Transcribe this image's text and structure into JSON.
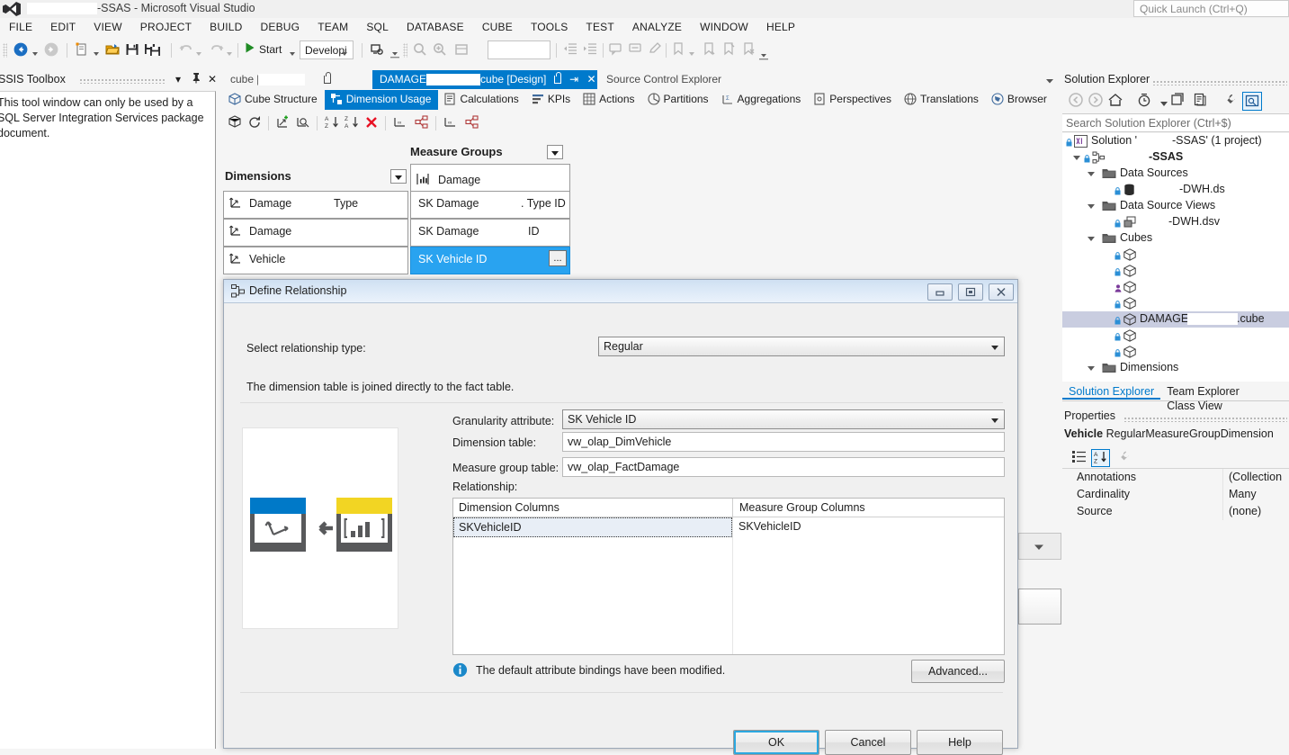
{
  "titlebar": {
    "app_title_suffix": "-SSAS - Microsoft Visual Studio",
    "quick_launch_placeholder": "Quick Launch (Ctrl+Q)"
  },
  "menubar": {
    "items": [
      "FILE",
      "EDIT",
      "VIEW",
      "PROJECT",
      "BUILD",
      "DEBUG",
      "TEAM",
      "SQL",
      "DATABASE",
      "CUBE",
      "TOOLS",
      "TEST",
      "ANALYZE",
      "WINDOW",
      "HELP"
    ]
  },
  "toolbar": {
    "start_label": "Start",
    "config_label": "Developi"
  },
  "ssis_toolbox": {
    "title": "SSIS Toolbox",
    "message": "This tool window can only be used by a SQL Server Integration Services package document.",
    "dropdown_glyph": "▾",
    "pin_glyph": "⇧",
    "close_glyph": "✕"
  },
  "document_tabs": {
    "inactive_tab": "cube [Design]",
    "active_tab_prefix": "DAMAGE",
    "active_tab_suffix": "cube [Design]",
    "third_tab": "Source Control Explorer"
  },
  "designer_tabs": [
    {
      "label": "Cube Structure",
      "icon": "cube-icon",
      "selected": false
    },
    {
      "label": "Dimension Usage",
      "icon": "dimension-usage-icon",
      "selected": true
    },
    {
      "label": "Calculations",
      "icon": "calculations-icon",
      "selected": false
    },
    {
      "label": "KPIs",
      "icon": "kpi-icon",
      "selected": false
    },
    {
      "label": "Actions",
      "icon": "actions-icon",
      "selected": false
    },
    {
      "label": "Partitions",
      "icon": "partitions-icon",
      "selected": false
    },
    {
      "label": "Aggregations",
      "icon": "aggregations-icon",
      "selected": false
    },
    {
      "label": "Perspectives",
      "icon": "perspectives-icon",
      "selected": false
    },
    {
      "label": "Translations",
      "icon": "translations-icon",
      "selected": false
    },
    {
      "label": "Browser",
      "icon": "browser-icon",
      "selected": false
    }
  ],
  "dimension_usage": {
    "measure_groups_label": "Measure Groups",
    "dimensions_label": "Dimensions",
    "measure_group_header": "Damage",
    "rows": [
      {
        "dimension": "Damage",
        "dimension_suffix": "Type",
        "cell": "SK Damage",
        "cell_suffix": ". Type ID",
        "selected": false
      },
      {
        "dimension": "Damage",
        "dimension_suffix": "",
        "cell": "SK Damage",
        "cell_suffix": "ID",
        "selected": false
      },
      {
        "dimension": "Vehicle",
        "dimension_suffix": "",
        "cell": "SK Vehicle ID",
        "cell_suffix": "",
        "selected": true
      }
    ],
    "ellipsis_label": "..."
  },
  "dialog": {
    "title": "Define Relationship",
    "relationship_type_label": "Select relationship type:",
    "relationship_type_value": "Regular",
    "description": "The dimension table is joined directly to the fact table.",
    "granularity_label": "Granularity attribute:",
    "granularity_value": "SK Vehicle ID",
    "dimension_table_label": "Dimension table:",
    "dimension_table_value": "vw_olap_DimVehicle",
    "measure_group_table_label": "Measure group table:",
    "measure_group_table_value": "vw_olap_FactDamage",
    "relationship_label": "Relationship:",
    "table_headers": [
      "Dimension Columns",
      "Measure Group Columns"
    ],
    "table_rows": [
      {
        "dimension_column": "SKVehicleID",
        "measure_group_column": "SKVehicleID"
      }
    ],
    "info_message": "The default attribute bindings have been modified.",
    "advanced_label": "Advanced...",
    "ok_label": "OK",
    "cancel_label": "Cancel",
    "help_label": "Help",
    "minimize_glyph": "minimize-icon",
    "restore_glyph": "restore-icon",
    "close_glyph": "close-icon",
    "graphic": {
      "dimension_color": "#0079c8",
      "fact_color": "#f2d523",
      "body_color": "#58595b"
    }
  },
  "solution_explorer": {
    "title": "Solution Explorer",
    "search_placeholder": "Search Solution Explorer (Ctrl+$)",
    "tree": [
      {
        "label": "Solution '",
        "label2": "-SSAS' (1 project)",
        "indent": 8,
        "level": 0,
        "icon": "solution-icon",
        "expander": "",
        "redact_w": 34,
        "selected": false
      },
      {
        "label": "",
        "label2": "-SSAS",
        "indent": 22,
        "level": 1,
        "icon": "project-icon",
        "expander": "open",
        "redact_w": 44,
        "selected": false,
        "bold": true
      },
      {
        "label": "Data Sources",
        "label2": "",
        "indent": 38,
        "level": 2,
        "icon": "folder-icon",
        "expander": "open",
        "redact_w": 0,
        "selected": false
      },
      {
        "label": "",
        "label2": "-DWH.ds",
        "indent": 58,
        "level": 3,
        "icon": "datasource-icon",
        "expander": "",
        "redact_w": 44,
        "selected": false
      },
      {
        "label": "Data Source Views",
        "label2": "",
        "indent": 38,
        "level": 2,
        "icon": "folder-icon",
        "expander": "open",
        "redact_w": 0,
        "selected": false
      },
      {
        "label": "",
        "label2": "-DWH.dsv",
        "indent": 58,
        "level": 3,
        "icon": "dsv-icon",
        "expander": "",
        "redact_w": 30,
        "selected": false
      },
      {
        "label": "Cubes",
        "label2": "",
        "indent": 38,
        "level": 2,
        "icon": "folder-icon",
        "expander": "open",
        "redact_w": 0,
        "selected": false
      },
      {
        "label": "",
        "label2": "",
        "indent": 58,
        "level": 3,
        "icon": "cube-item-icon",
        "expander": "",
        "redact_w": 80,
        "selected": false
      },
      {
        "label": "",
        "label2": "",
        "indent": 58,
        "level": 3,
        "icon": "cube-item-icon",
        "expander": "",
        "redact_w": 86,
        "selected": false
      },
      {
        "label": "",
        "label2": "",
        "indent": 58,
        "level": 3,
        "icon": "cube-item-icon",
        "expander": "",
        "redact_w": 72,
        "selected": false
      },
      {
        "label": "",
        "label2": "",
        "indent": 58,
        "level": 3,
        "icon": "cube-item-icon",
        "expander": "",
        "redact_w": 64,
        "selected": false
      },
      {
        "label": "DAMAGE",
        "label2": ".cube",
        "indent": 58,
        "level": 3,
        "icon": "cube-item-icon",
        "expander": "",
        "redact_w": 56,
        "selected": true
      },
      {
        "label": "",
        "label2": "",
        "indent": 58,
        "level": 3,
        "icon": "cube-item-icon",
        "expander": "",
        "redact_w": 110,
        "selected": false
      },
      {
        "label": "",
        "label2": "",
        "indent": 58,
        "level": 3,
        "icon": "cube-item-icon",
        "expander": "",
        "redact_w": 72,
        "selected": false
      },
      {
        "label": "Dimensions",
        "label2": "",
        "indent": 38,
        "level": 2,
        "icon": "folder-icon",
        "expander": "open",
        "redact_w": 0,
        "selected": false
      }
    ],
    "bottom_tabs": [
      {
        "label": "Solution Explorer",
        "active": true
      },
      {
        "label": "Team Explorer",
        "active": false
      },
      {
        "label": "Class View",
        "active": false
      }
    ]
  },
  "properties": {
    "title": "Properties",
    "object_name": "Vehicle",
    "object_type": "RegularMeasureGroupDimension",
    "rows": [
      {
        "name": "Annotations",
        "value": "(Collection"
      },
      {
        "name": "Cardinality",
        "value": "Many"
      },
      {
        "name": "Source",
        "value": "(none)"
      }
    ]
  }
}
